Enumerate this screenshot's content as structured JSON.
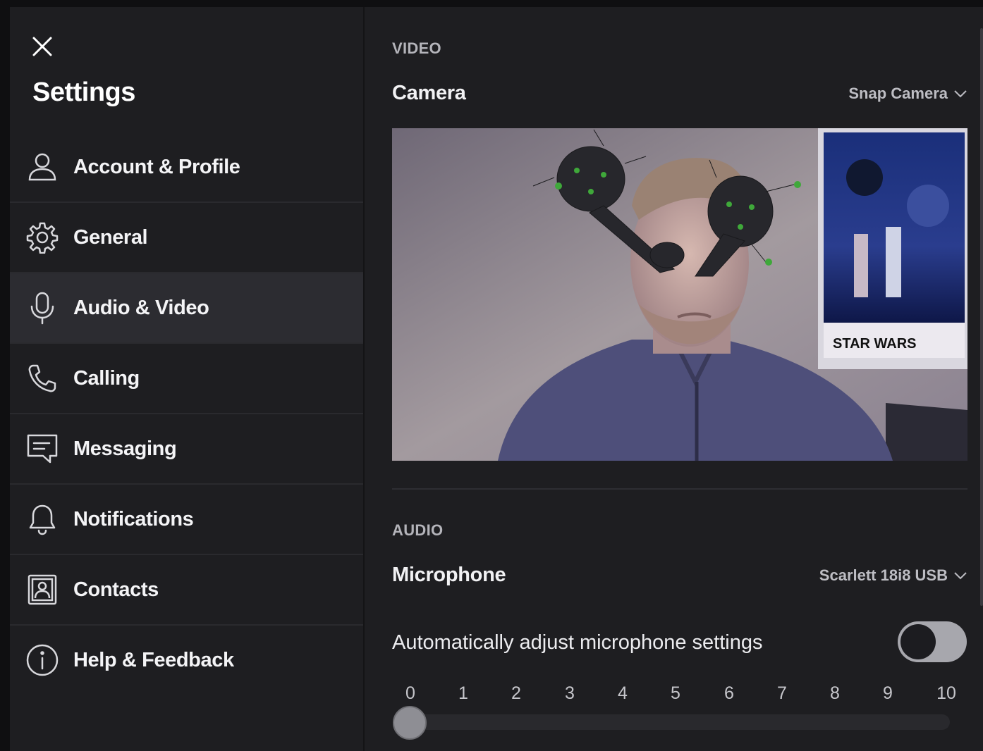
{
  "sidebar": {
    "title": "Settings",
    "close_icon": "close-icon",
    "items": [
      {
        "label": "Account & Profile",
        "icon": "user-icon",
        "active": false
      },
      {
        "label": "General",
        "icon": "gear-icon",
        "active": false
      },
      {
        "label": "Audio & Video",
        "icon": "microphone-icon",
        "active": true
      },
      {
        "label": "Calling",
        "icon": "phone-icon",
        "active": false
      },
      {
        "label": "Messaging",
        "icon": "message-icon",
        "active": false
      },
      {
        "label": "Notifications",
        "icon": "bell-icon",
        "active": false
      },
      {
        "label": "Contacts",
        "icon": "contact-card-icon",
        "active": false
      },
      {
        "label": "Help & Feedback",
        "icon": "info-icon",
        "active": false
      }
    ]
  },
  "video": {
    "section_label": "VIDEO",
    "camera_label": "Camera",
    "camera_value": "Snap Camera"
  },
  "audio": {
    "section_label": "AUDIO",
    "microphone_label": "Microphone",
    "microphone_value": "Scarlett 18i8 USB",
    "auto_adjust_label": "Automatically adjust microphone settings",
    "auto_adjust_on": false,
    "level_ticks": [
      "0",
      "1",
      "2",
      "3",
      "4",
      "5",
      "6",
      "7",
      "8",
      "9",
      "10"
    ],
    "level_value": 0
  },
  "colors": {
    "background": "#1e1e21",
    "active_item": "#2c2c31",
    "muted_text": "#b4b4ba"
  }
}
